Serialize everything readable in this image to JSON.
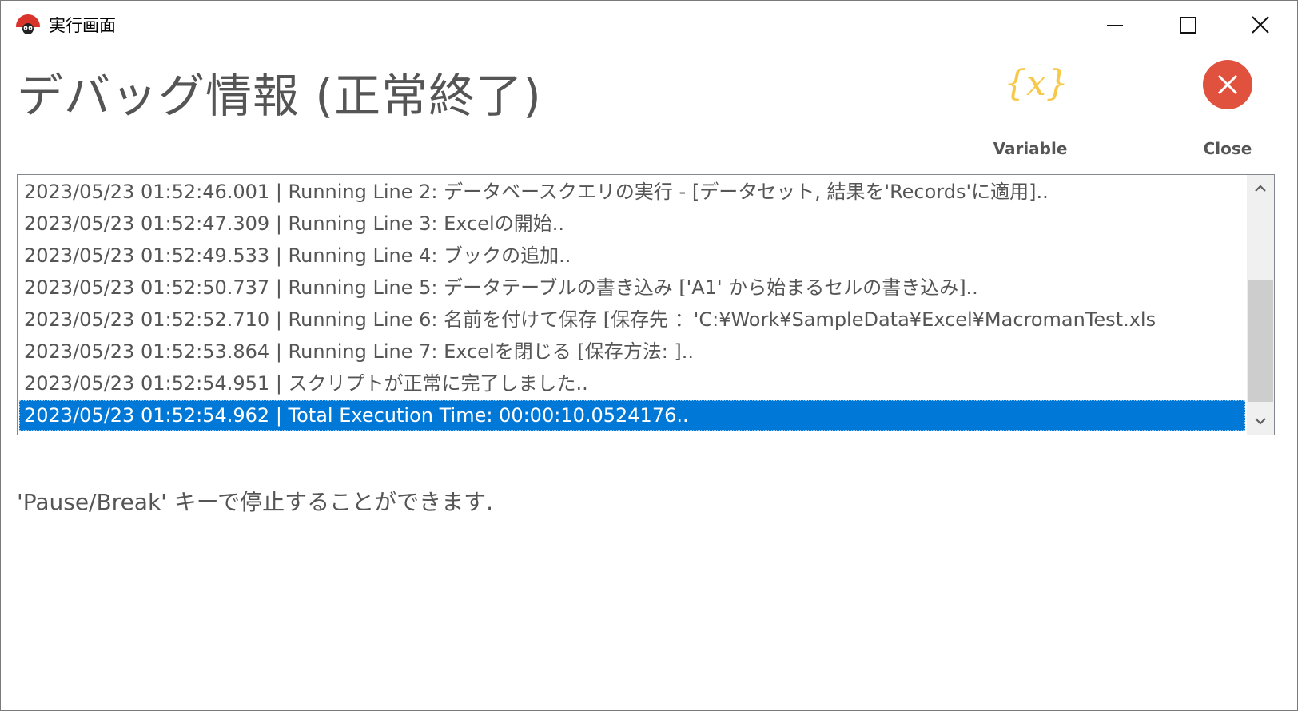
{
  "window": {
    "title": "実行画面"
  },
  "header": {
    "title": "デバッグ情報 (正常終了)"
  },
  "tools": {
    "variable_label": "Variable",
    "variable_glyph": "{x}",
    "close_label": "Close"
  },
  "log": {
    "rows": [
      "2023/05/23 01:52:46.001 | Running Line 2: データベースクエリの実行 - [データセット, 結果を'Records'に適用]..",
      "2023/05/23 01:52:47.309 | Running Line 3: Excelの開始..",
      "2023/05/23 01:52:49.533 | Running Line 4: ブックの追加..",
      "2023/05/23 01:52:50.737 | Running Line 5: データテーブルの書き込み ['A1' から始まるセルの書き込み]..",
      "2023/05/23 01:52:52.710 | Running Line 6: 名前を付けて保存 [保存先 ：'C:¥Work¥SampleData¥Excel¥MacromanTest.xls",
      "2023/05/23 01:52:53.864 | Running Line 7: Excelを閉じる [保存方法: ]..",
      "2023/05/23 01:52:54.951 | スクリプトが正常に完了しました..",
      "2023/05/23 01:52:54.962 | Total Execution Time: 00:00:10.0524176.."
    ],
    "selected_index": 7
  },
  "hint": {
    "text": "'Pause/Break' キーで停止することができます."
  },
  "colors": {
    "selection": "#0078d7",
    "close_button": "#e0513e",
    "variable_icon": "#f7c948",
    "text": "#555555"
  }
}
